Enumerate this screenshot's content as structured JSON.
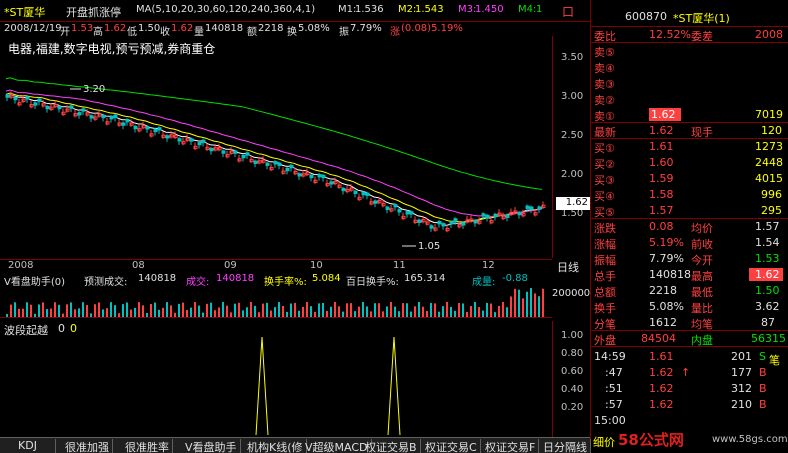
{
  "header": {
    "stock_name": "*ST厦华",
    "formula": "开盘抓涨停",
    "ma_params": "MA(5,10,20,30,60,120,240,360,4,1)",
    "m1_label": "M1:",
    "m1": "1.536",
    "m2_label": "M2:",
    "m2": "1.543",
    "m3_label": "M3:",
    "m3": "1.450",
    "m4_label": "M4:",
    "m4": "1",
    "flag": "口"
  },
  "infobar": {
    "date": "2008/12/19",
    "open_label": "开",
    "open": "1.53",
    "high_label": "高",
    "high": "1.62",
    "low_label": "低",
    "low": "1.50",
    "close_label": "收",
    "close": "1.62",
    "vol_label": "量",
    "vol": "140818",
    "amt_label": "额",
    "amt": "2218",
    "turn_label": "换",
    "turn": "5.08%",
    "amp_label": "振",
    "amp": "7.79%",
    "chg_label": "涨",
    "chg": "(0.08)5.19%"
  },
  "tagline": "电器,福建,数字电视,预亏预减,券商重仓",
  "main_chart": {
    "y_ticks": [
      "3.50",
      "3.00",
      "2.50",
      "2.00",
      "1.50"
    ],
    "high_annotation": "3.20",
    "low_annotation": "1.05",
    "price_marker": "1.62"
  },
  "date_axis": {
    "ticks": [
      "2008",
      "08",
      "09",
      "10",
      "11",
      "12"
    ],
    "cycle_label": "日线"
  },
  "volume_panel": {
    "title": "V看盘助手(0)",
    "pred_label": "预测成交:",
    "pred": "140818",
    "deal_label": "成交:",
    "deal": "140818",
    "turn_label": "换手率%:",
    "turn": "5.084",
    "hundred_label": "百日换手%:",
    "hundred": "165.314",
    "ratio_label": "成量:",
    "ratio": "-0.88",
    "y_tick": "200000"
  },
  "indicator_panel": {
    "title": "波段起越",
    "v1": "0",
    "v2": "0",
    "y_ticks": [
      "1.00",
      "0.80",
      "0.60",
      "0.40",
      "0.20"
    ]
  },
  "right_panel": {
    "code": "600870",
    "name": "*ST厦华(1)",
    "wei_bi_label": "委比",
    "wei_bi": "12.52%",
    "wei_cha_label": "委差",
    "wei_cha": "2008",
    "sells": [
      {
        "label": "卖⑤",
        "price": "",
        "vol": ""
      },
      {
        "label": "卖④",
        "price": "",
        "vol": ""
      },
      {
        "label": "卖③",
        "price": "",
        "vol": ""
      },
      {
        "label": "卖②",
        "price": "",
        "vol": ""
      },
      {
        "label": "卖①",
        "price": "1.62",
        "vol": "7019"
      }
    ],
    "last_label": "最新",
    "last": "1.62",
    "now_vol_label": "现手",
    "now_vol": "120",
    "buys": [
      {
        "label": "买①",
        "price": "1.61",
        "vol": "1273"
      },
      {
        "label": "买②",
        "price": "1.60",
        "vol": "2448"
      },
      {
        "label": "买③",
        "price": "1.59",
        "vol": "4015"
      },
      {
        "label": "买④",
        "price": "1.58",
        "vol": "996"
      },
      {
        "label": "买⑤",
        "price": "1.57",
        "vol": "295"
      }
    ],
    "stats": [
      {
        "l1": "涨跌",
        "v1": "0.08",
        "l2": "均价",
        "v2": "1.57"
      },
      {
        "l1": "涨幅",
        "v1": "5.19%",
        "l2": "前收",
        "v2": "1.54"
      },
      {
        "l1": "振幅",
        "v1": "7.79%",
        "l2": "今开",
        "v2": "1.53"
      },
      {
        "l1": "总手",
        "v1": "140818",
        "l2": "最高",
        "v2": "1.62"
      },
      {
        "l1": "总额",
        "v1": "2218",
        "l2": "最低",
        "v2": "1.50"
      },
      {
        "l1": "换手",
        "v1": "5.08%",
        "l2": "量比",
        "v2": "3.62"
      },
      {
        "l1": "分笔",
        "v1": "1612",
        "l2": "均笔",
        "v2": "87"
      }
    ],
    "outer_label": "外盘",
    "outer": "84504",
    "inner_label": "内盘",
    "inner": "56315",
    "ticks": [
      {
        "time": "14:59",
        "price": "1.61",
        "arrow": "",
        "vol": "201",
        "side": "S"
      },
      {
        "time": ":47",
        "price": "1.62",
        "arrow": "↑",
        "vol": "177",
        "side": "B"
      },
      {
        "time": ":51",
        "price": "1.62",
        "arrow": "",
        "vol": "312",
        "side": "B"
      },
      {
        "time": ":57",
        "price": "1.62",
        "arrow": "",
        "vol": "210",
        "side": "B"
      },
      {
        "time": "15:00",
        "price": "",
        "arrow": "",
        "vol": "",
        "side": ""
      }
    ],
    "side_label": "笔",
    "detail_label": "细价"
  },
  "tabs": [
    "KDJ",
    "很准加强",
    "很准胜率",
    "V看盘助手",
    "机构K线(修",
    "V超级MACD",
    "权证交易B",
    "权证交易C",
    "权证交易F",
    "日分隔线"
  ],
  "watermark": {
    "brand": "58公式网",
    "url": "www.58gs.com"
  },
  "chart_data": {
    "type": "line",
    "title": "",
    "x": [
      "2008",
      "08",
      "09",
      "10",
      "11",
      "12"
    ],
    "series": [
      {
        "name": "",
        "values": [
          3.0,
          2.7,
          2.3,
          1.9,
          1.3,
          1.55
        ]
      }
    ],
    "ylim": [
      0.9,
      3.8
    ]
  }
}
